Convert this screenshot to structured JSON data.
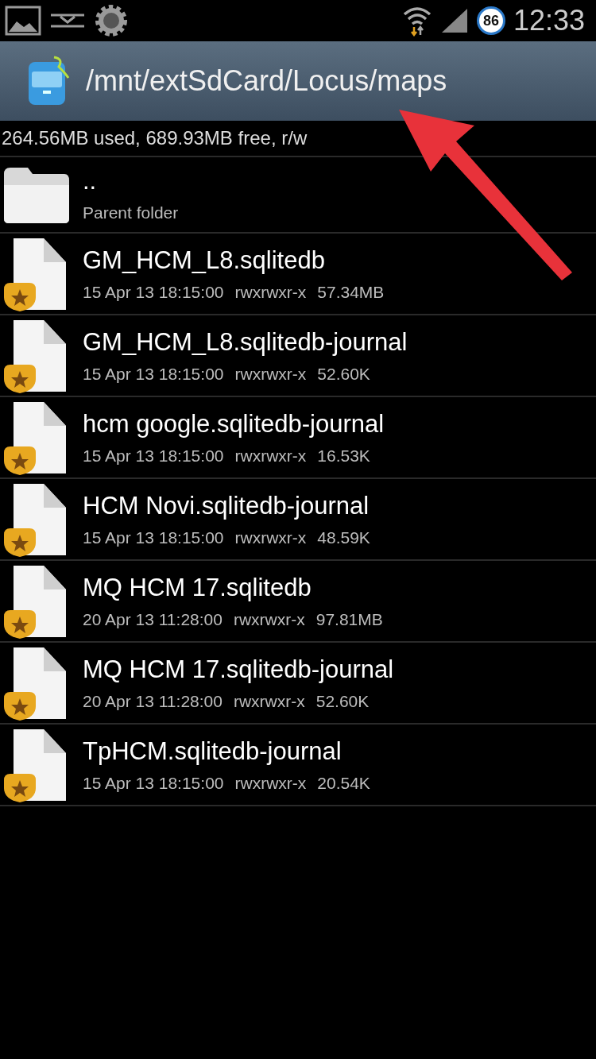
{
  "status_bar": {
    "battery": "86",
    "time": "12:33"
  },
  "header": {
    "path": "/mnt/extSdCard/Locus/maps"
  },
  "storage_info": "264.56MB used, 689.93MB free, r/w",
  "files": [
    {
      "kind": "parent",
      "name": "..",
      "subtitle": "Parent folder"
    },
    {
      "kind": "file",
      "name": "GM_HCM_L8.sqlitedb",
      "date": "15 Apr 13 18:15:00",
      "permissions": "rwxrwxr-x",
      "size": "57.34MB"
    },
    {
      "kind": "file",
      "name": "GM_HCM_L8.sqlitedb-journal",
      "date": "15 Apr 13 18:15:00",
      "permissions": "rwxrwxr-x",
      "size": "52.60K"
    },
    {
      "kind": "file",
      "name": "hcm google.sqlitedb-journal",
      "date": "15 Apr 13 18:15:00",
      "permissions": "rwxrwxr-x",
      "size": "16.53K"
    },
    {
      "kind": "file",
      "name": "HCM Novi.sqlitedb-journal",
      "date": "15 Apr 13 18:15:00",
      "permissions": "rwxrwxr-x",
      "size": "48.59K"
    },
    {
      "kind": "file",
      "name": "MQ HCM 17.sqlitedb",
      "date": "20 Apr 13 11:28:00",
      "permissions": "rwxrwxr-x",
      "size": "97.81MB"
    },
    {
      "kind": "file",
      "name": "MQ HCM 17.sqlitedb-journal",
      "date": "20 Apr 13 11:28:00",
      "permissions": "rwxrwxr-x",
      "size": "52.60K"
    },
    {
      "kind": "file",
      "name": "TpHCM.sqlitedb-journal",
      "date": "15 Apr 13 18:15:00",
      "permissions": "rwxrwxr-x",
      "size": "20.54K"
    }
  ]
}
